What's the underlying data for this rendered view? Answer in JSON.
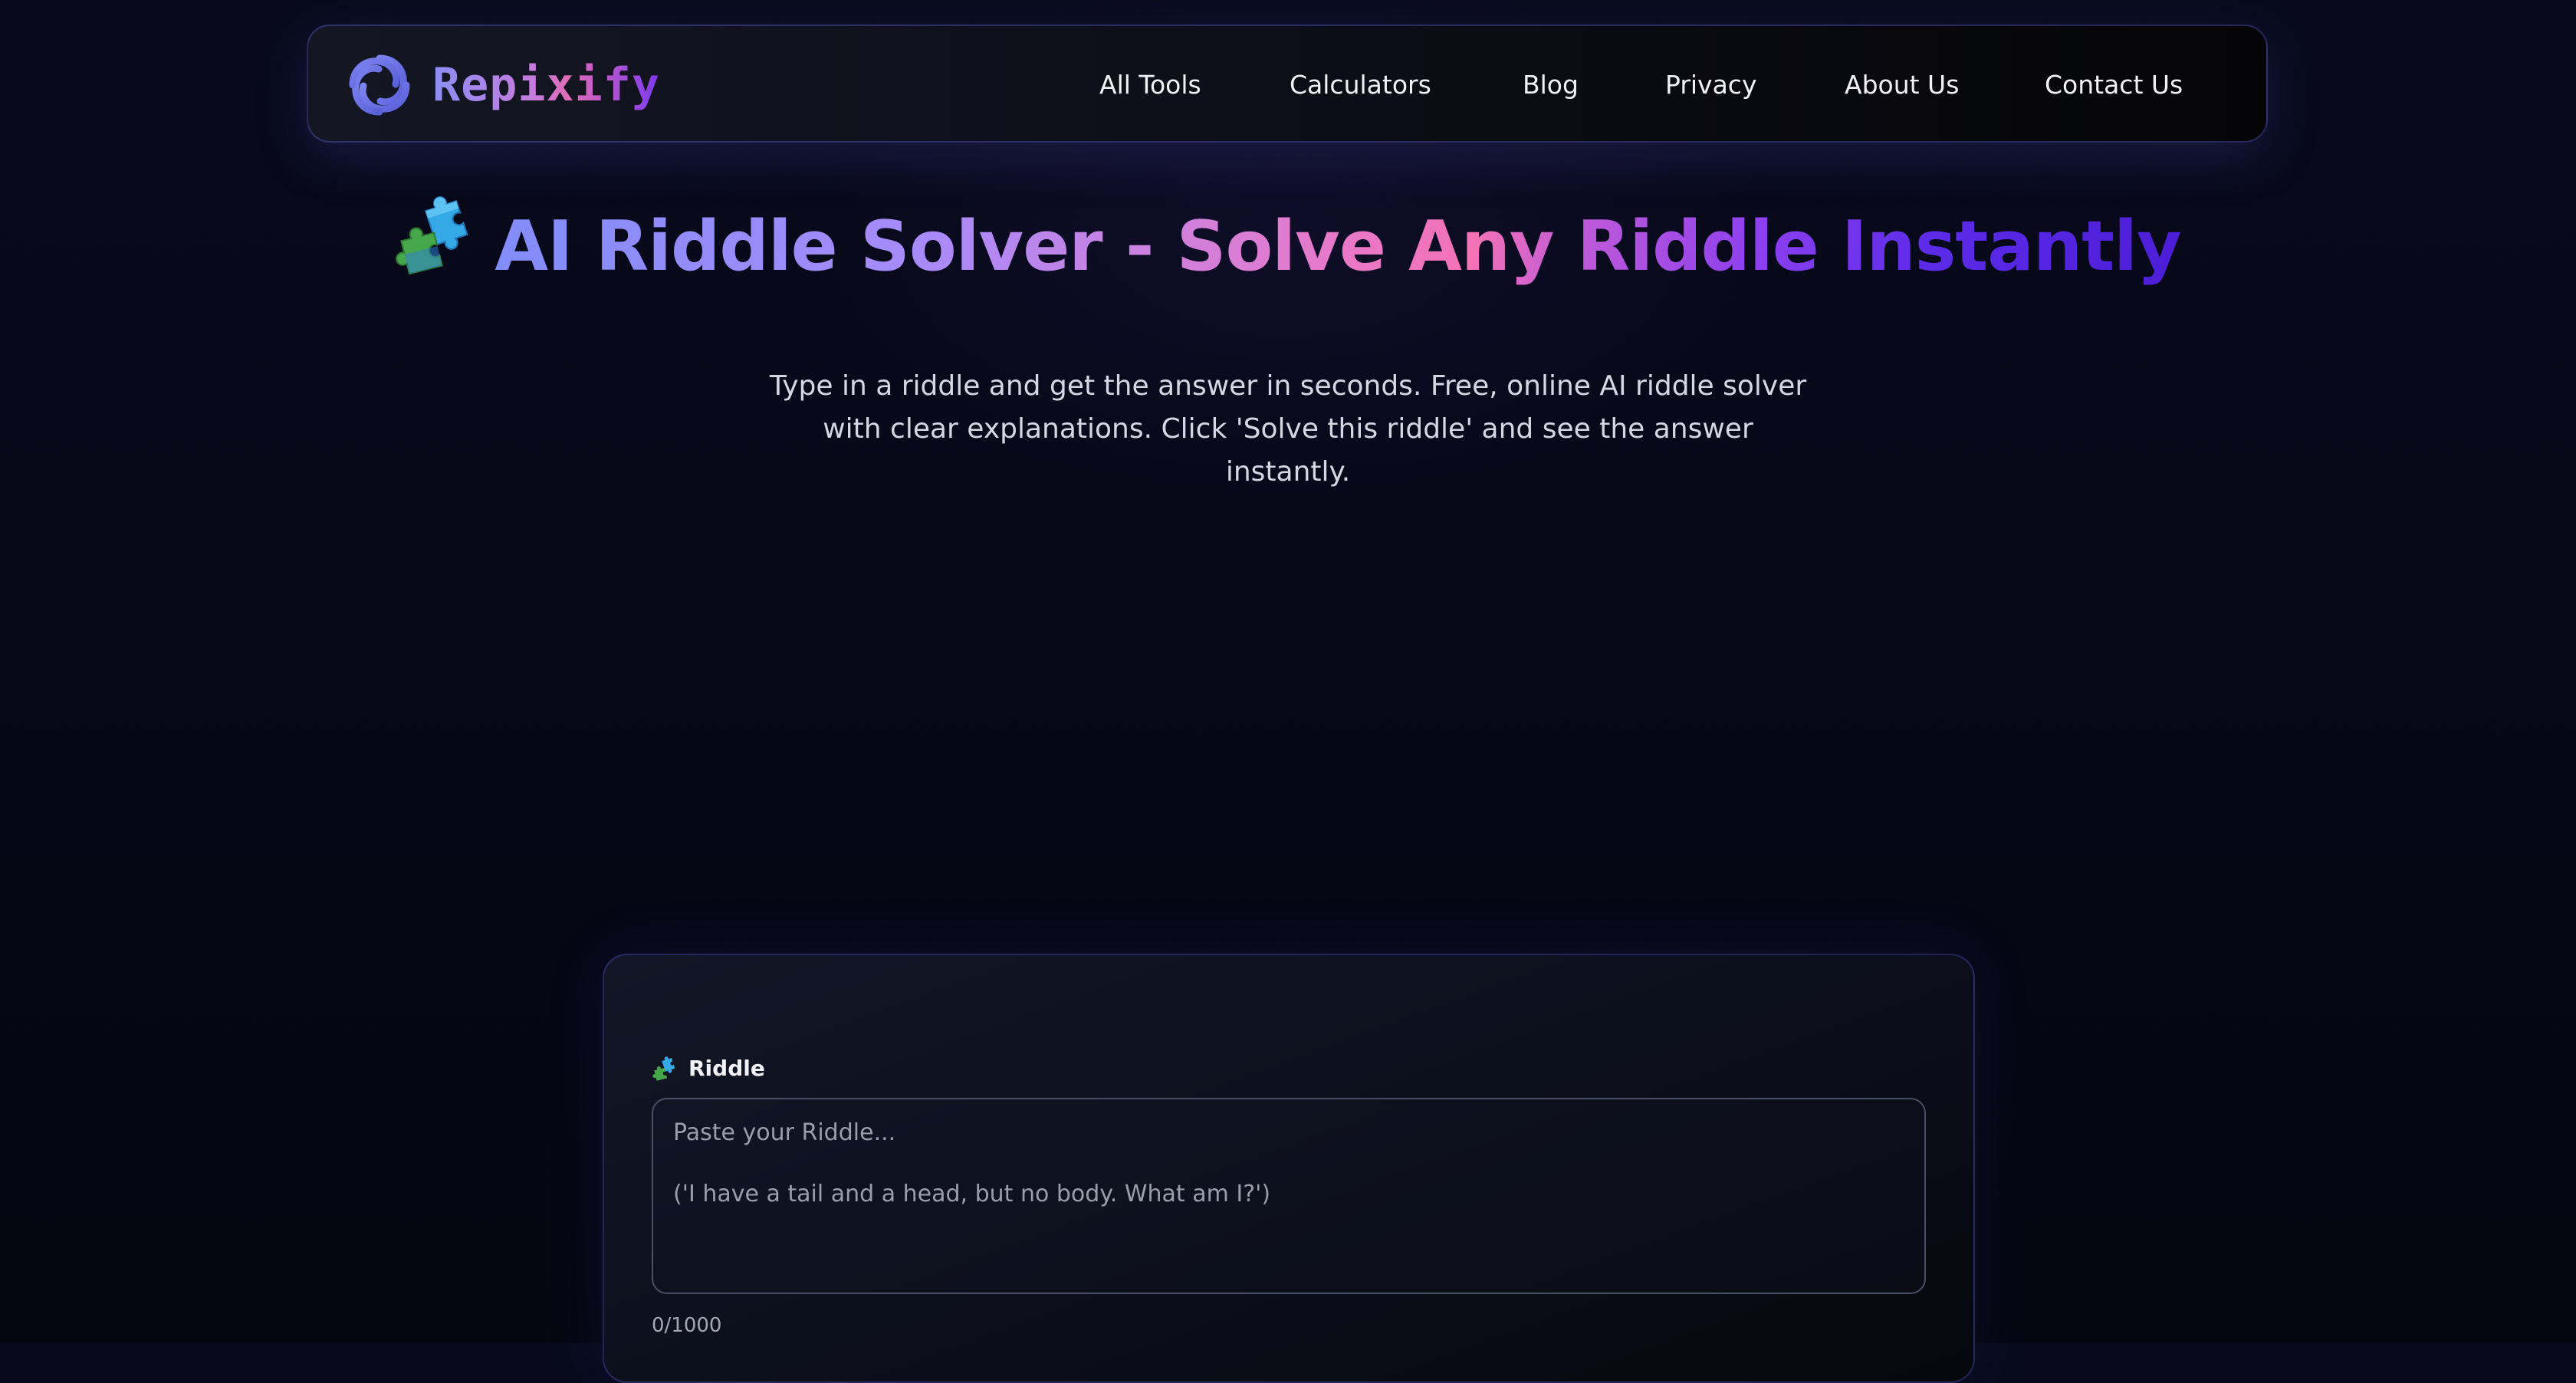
{
  "brand": {
    "name": "Repixify",
    "gradient_colors": [
      "#8b8ff5",
      "#c77bdc",
      "#e06bb8",
      "#7c3aed"
    ]
  },
  "nav": {
    "items": [
      {
        "label": "All Tools"
      },
      {
        "label": "Calculators"
      },
      {
        "label": "Blog"
      },
      {
        "label": "Privacy"
      },
      {
        "label": "About Us"
      },
      {
        "label": "Contact Us"
      }
    ]
  },
  "hero": {
    "icon": "puzzle-piece-icon",
    "title": "AI Riddle Solver - Solve Any Riddle Instantly",
    "subtitle": "Type in a riddle and get the answer in seconds. Free, online AI riddle solver with clear explanations. Click 'Solve this riddle' and see the answer instantly."
  },
  "form": {
    "label_icon": "puzzle-piece-icon",
    "label": "Riddle",
    "placeholder_line1": "Paste your Riddle...",
    "placeholder_line2": "('I have a tail and a head, but no body. What am I?')",
    "value": "",
    "counter": "0/1000"
  },
  "colors": {
    "background": "#070818",
    "card_border": "#4f46e5",
    "text": "#e8e8f0"
  }
}
